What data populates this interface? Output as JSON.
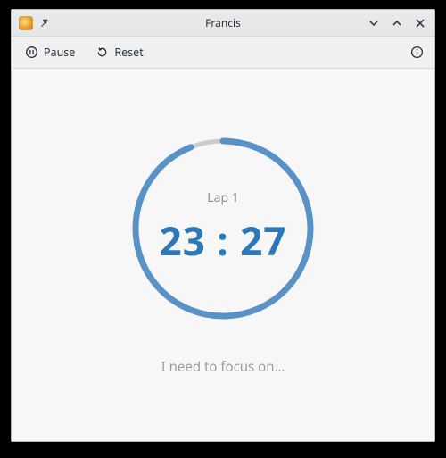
{
  "window": {
    "title": "Francis"
  },
  "toolbar": {
    "pause_label": "Pause",
    "reset_label": "Reset"
  },
  "timer": {
    "lap_label": "Lap 1",
    "time": "23 : 27",
    "progress_percent": 94
  },
  "focus": {
    "placeholder": "I need to focus on…"
  },
  "colors": {
    "accent": "#2d78b7",
    "ring": "#5992c7"
  }
}
